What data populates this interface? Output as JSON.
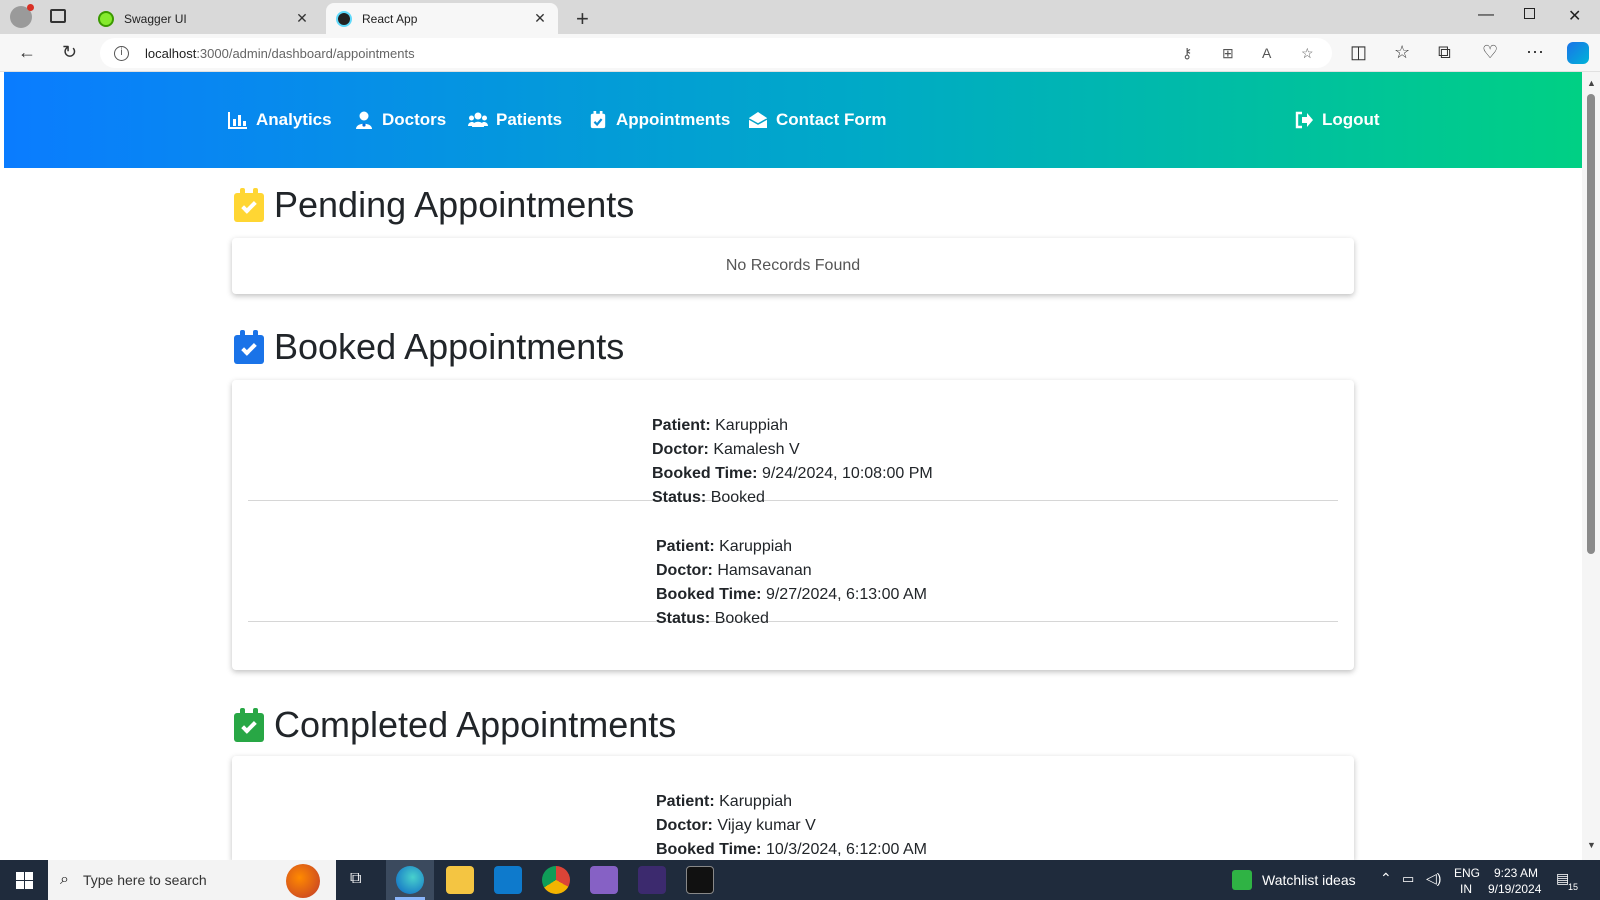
{
  "browser": {
    "tabs": [
      {
        "title": "Swagger UI",
        "active": false,
        "favicon_color": "#85ea2d"
      },
      {
        "title": "React App",
        "active": true,
        "favicon_color": "#222222"
      }
    ],
    "url_host": "localhost",
    "url_path": ":3000/admin/dashboard/appointments"
  },
  "nav": {
    "items": [
      {
        "label": "Analytics",
        "icon": "chart-bar-icon"
      },
      {
        "label": "Doctors",
        "icon": "user-doctor-icon"
      },
      {
        "label": "Patients",
        "icon": "users-icon"
      },
      {
        "label": "Appointments",
        "icon": "calendar-check-icon"
      },
      {
        "label": "Contact Form",
        "icon": "envelope-open-icon"
      }
    ],
    "logout_label": "Logout",
    "gradient": [
      "#0a7cff",
      "#00aac6",
      "#00d084"
    ]
  },
  "sections": {
    "pending": {
      "title": "Pending Appointments",
      "icon_color": "#ffd633",
      "empty_text": "No Records Found"
    },
    "booked": {
      "title": "Booked Appointments",
      "icon_color": "#1a73e8",
      "items": [
        {
          "patient": "Karuppiah",
          "doctor": "Kamalesh V",
          "booked_time": "9/24/2024, 10:08:00 PM",
          "status": "Booked"
        },
        {
          "patient": "Karuppiah",
          "doctor": "Hamsavanan",
          "booked_time": "9/27/2024, 6:13:00 AM",
          "status": "Booked"
        }
      ]
    },
    "completed": {
      "title": "Completed Appointments",
      "icon_color": "#28a745",
      "items": [
        {
          "patient": "Karuppiah",
          "doctor": "Vijay kumar V",
          "booked_time": "10/3/2024, 6:12:00 AM"
        }
      ]
    }
  },
  "labels": {
    "patient": "Patient:",
    "doctor": "Doctor:",
    "booked_time": "Booked Time:",
    "status": "Status:"
  },
  "taskbar": {
    "search_placeholder": "Type here to search",
    "widget_label": "Watchlist ideas",
    "lang_top": "ENG",
    "lang_bottom": "IN",
    "time": "9:23 AM",
    "date": "9/19/2024",
    "notification_count": "15"
  }
}
